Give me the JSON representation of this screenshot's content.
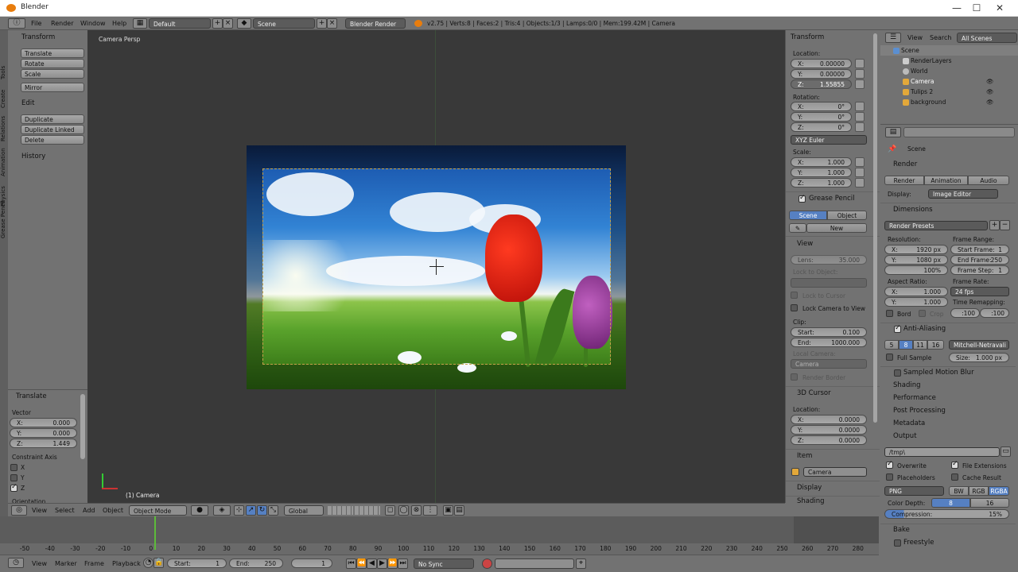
{
  "window": {
    "title": "Blender",
    "controls": {
      "minimize": "—",
      "maximize": "☐",
      "close": "✕"
    }
  },
  "infobar": {
    "menus": [
      "File",
      "Render",
      "Window",
      "Help"
    ],
    "screen_layout": "Default",
    "scene": "Scene",
    "engine": "Blender Render",
    "stats": "v2.75 | Verts:8 | Faces:2 | Tris:4 | Objects:1/3 | Lamps:0/0 | Mem:199.42M | Camera"
  },
  "toolshelf": {
    "tabs": [
      "Tools",
      "Create",
      "Relations",
      "Animation",
      "Physics",
      "Grease Pencil"
    ],
    "transform_header": "Transform",
    "transform_buttons": [
      "Translate",
      "Rotate",
      "Scale",
      "Mirror"
    ],
    "edit_header": "Edit",
    "edit_buttons": [
      "Duplicate",
      "Duplicate Linked",
      "Delete"
    ],
    "history_header": "History"
  },
  "operator": {
    "header": "Translate",
    "vector_label": "Vector",
    "vector": [
      {
        "axis": "X:",
        "value": "0.000"
      },
      {
        "axis": "Y:",
        "value": "0.000"
      },
      {
        "axis": "Z:",
        "value": "1.449"
      }
    ],
    "constraint_label": "Constraint Axis",
    "constraints": [
      {
        "label": "X",
        "checked": false
      },
      {
        "label": "Y",
        "checked": false
      },
      {
        "label": "Z",
        "checked": true
      }
    ],
    "orientation_label": "Orientation"
  },
  "viewport": {
    "view_name": "Camera Persp",
    "object_name": "(1) Camera"
  },
  "nprops": {
    "transform_header": "Transform",
    "location_label": "Location:",
    "location": [
      {
        "axis": "X:",
        "value": "0.00000"
      },
      {
        "axis": "Y:",
        "value": "0.00000"
      },
      {
        "axis": "Z:",
        "value": "1.55855"
      }
    ],
    "rotation_label": "Rotation:",
    "rotation": [
      {
        "axis": "X:",
        "value": "0°"
      },
      {
        "axis": "Y:",
        "value": "0°"
      },
      {
        "axis": "Z:",
        "value": "0°"
      }
    ],
    "rotation_mode": "XYZ Euler",
    "scale_label": "Scale:",
    "scale": [
      {
        "axis": "X:",
        "value": "1.000"
      },
      {
        "axis": "Y:",
        "value": "1.000"
      },
      {
        "axis": "Z:",
        "value": "1.000"
      }
    ],
    "grease_pencil_header": "Grease Pencil",
    "gp_tabs": [
      "Scene",
      "Object"
    ],
    "gp_new": "New",
    "view_header": "View",
    "lens_label": "Lens:",
    "lens_value": "35.000",
    "lock_object_label": "Lock to Object:",
    "lock_cursor": "Lock to Cursor",
    "lock_camera": "Lock Camera to View",
    "clip_label": "Clip:",
    "clip_start_label": "Start:",
    "clip_start": "0.100",
    "clip_end_label": "End:",
    "clip_end": "1000.000",
    "local_camera_label": "Local Camera:",
    "local_camera": "Camera",
    "render_border": "Render Border",
    "cursor_header": "3D Cursor",
    "cursor_location_label": "Location:",
    "cursor": [
      {
        "axis": "X:",
        "value": "0.0000"
      },
      {
        "axis": "Y:",
        "value": "0.0000"
      },
      {
        "axis": "Z:",
        "value": "0.0000"
      }
    ],
    "item_header": "Item",
    "item_name": "Camera",
    "display_header": "Display",
    "shading_header": "Shading"
  },
  "outliner": {
    "menus": [
      "View",
      "Search"
    ],
    "filter": "All Scenes",
    "rows": [
      {
        "name": "Scene",
        "depth": 0
      },
      {
        "name": "RenderLayers",
        "depth": 1
      },
      {
        "name": "World",
        "depth": 1
      },
      {
        "name": "Camera",
        "depth": 1
      },
      {
        "name": "Tulips 2",
        "depth": 1
      },
      {
        "name": "background",
        "depth": 1
      }
    ]
  },
  "properties": {
    "breadcrumb": "Scene",
    "render_header": "Render",
    "render_buttons": [
      "Render",
      "Animation",
      "Audio"
    ],
    "display_label": "Display:",
    "display_value": "Image Editor",
    "dimensions_header": "Dimensions",
    "render_presets": "Render Presets",
    "resolution_label": "Resolution:",
    "res_x_label": "X:",
    "res_x": "1920 px",
    "res_y_label": "Y:",
    "res_y": "1080 px",
    "res_pct": "100%",
    "frame_range_label": "Frame Range:",
    "start_frame_label": "Start Frame:",
    "start_frame": "1",
    "end_frame_label": "End Frame:",
    "end_frame": "250",
    "frame_step_label": "Frame Step:",
    "frame_step": "1",
    "aspect_label": "Aspect Ratio:",
    "aspect_x": "1.000",
    "aspect_y": "1.000",
    "frame_rate_label": "Frame Rate:",
    "frame_rate": "24 fps",
    "time_remap_label": "Time Remapping:",
    "remap_old": ":100",
    "remap_new": ":100",
    "bord": "Bord",
    "crop": "Crop",
    "aa_header": "Anti-Aliasing",
    "aa_samples": [
      "5",
      "8",
      "11",
      "16"
    ],
    "aa_filter": "Mitchell-Netravali",
    "full_sample": "Full Sample",
    "size_label": "Size:",
    "size_value": "1.000 px",
    "motion_blur_header": "Sampled Motion Blur",
    "shading_header": "Shading",
    "performance_header": "Performance",
    "post_header": "Post Processing",
    "metadata_header": "Metadata",
    "output_header": "Output",
    "output_path": "/tmp\\",
    "overwrite": "Overwrite",
    "file_extensions": "File Extensions",
    "placeholders": "Placeholders",
    "cache_result": "Cache Result",
    "format": "PNG",
    "color_modes": [
      "BW",
      "RGB",
      "RGBA"
    ],
    "color_depth_label": "Color Depth:",
    "color_depths": [
      "8",
      "16"
    ],
    "compression_label": "Compression:",
    "compression": "15%",
    "bake_header": "Bake",
    "freestyle_header": "Freestyle"
  },
  "view_header": {
    "menus": [
      "View",
      "Select",
      "Add",
      "Object"
    ],
    "mode": "Object Mode",
    "orientation": "Global"
  },
  "timeline": {
    "ticks": [
      "-50",
      "-40",
      "-30",
      "-20",
      "-10",
      "0",
      "10",
      "20",
      "30",
      "40",
      "50",
      "60",
      "70",
      "80",
      "90",
      "100",
      "110",
      "120",
      "130",
      "140",
      "150",
      "160",
      "170",
      "180",
      "190",
      "200",
      "210",
      "220",
      "230",
      "240",
      "250",
      "260",
      "270",
      "280"
    ],
    "current_frame": 0,
    "menus": [
      "View",
      "Marker",
      "Frame",
      "Playback"
    ],
    "start_label": "Start:",
    "start": "1",
    "end_label": "End:",
    "end": "250",
    "current": "1",
    "sync": "No Sync"
  }
}
